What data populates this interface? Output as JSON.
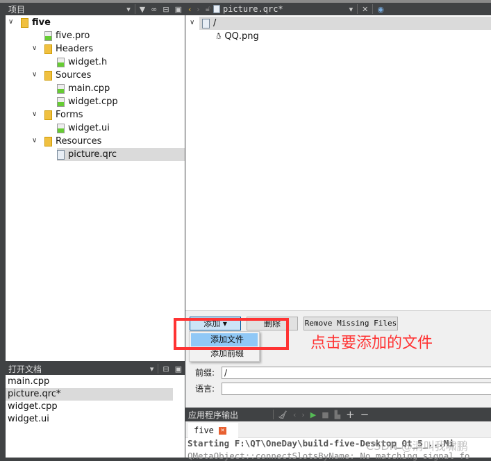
{
  "projects_pane": {
    "title": "项目",
    "tree": [
      {
        "label": "five",
        "level": 0,
        "expanded": true,
        "bold": true,
        "icon": "project-folder-icon"
      },
      {
        "label": "five.pro",
        "level": 1,
        "icon": "pro-file-icon"
      },
      {
        "label": "Headers",
        "level": 1,
        "expanded": true,
        "icon": "headers-folder-icon"
      },
      {
        "label": "widget.h",
        "level": 2,
        "icon": "source-file-icon"
      },
      {
        "label": "Sources",
        "level": 1,
        "expanded": true,
        "icon": "sources-folder-icon"
      },
      {
        "label": "main.cpp",
        "level": 2,
        "icon": "source-file-icon"
      },
      {
        "label": "widget.cpp",
        "level": 2,
        "icon": "source-file-icon"
      },
      {
        "label": "Forms",
        "level": 1,
        "expanded": true,
        "icon": "forms-folder-icon"
      },
      {
        "label": "widget.ui",
        "level": 2,
        "icon": "ui-file-icon"
      },
      {
        "label": "Resources",
        "level": 1,
        "expanded": true,
        "icon": "resources-folder-icon"
      },
      {
        "label": "picture.qrc",
        "level": 2,
        "selected": true,
        "icon": "qrc-file-icon"
      }
    ]
  },
  "open_docs": {
    "title": "打开文档",
    "items": [
      "main.cpp",
      "picture.qrc*",
      "widget.cpp",
      "widget.ui"
    ],
    "selected": 1
  },
  "editor": {
    "file": "picture.qrc*",
    "prefix": "/",
    "files": [
      "QQ.png"
    ]
  },
  "resource_panel": {
    "add": "添加",
    "remove": "删除",
    "remove_missing": "Remove Missing Files",
    "menu": [
      "添加文件",
      "添加前缀"
    ],
    "prefix_label": "前缀:",
    "prefix_value": "/",
    "lang_label": "语言:",
    "lang_value": ""
  },
  "output": {
    "title": "应用程序输出",
    "tab": "five",
    "lines": [
      "Starting F:\\QT\\OneDay\\build-five-Desktop_Qt_5_...Mi",
      "QMetaObject::connectSlotsByName: No matching signal fo"
    ]
  },
  "annotation": {
    "text": "点击要添加的文件",
    "color": "#ff3333"
  },
  "watermark": "CSDN @清叫我啸鹏"
}
